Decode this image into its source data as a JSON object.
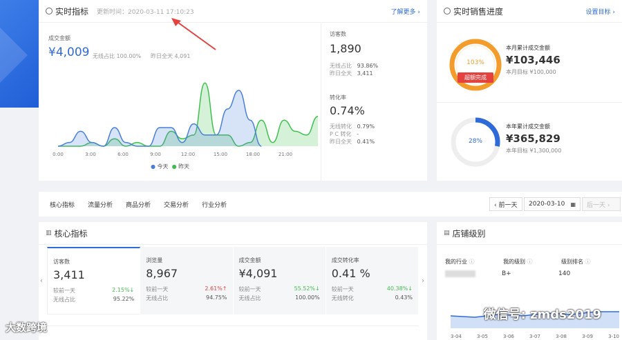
{
  "realtime": {
    "title": "实时指标",
    "updated": "更新时间：2020-03-11 17:10:23",
    "more": "了解更多 ›",
    "deal_label": "成交金额",
    "deal_value": "¥4,009",
    "wireless_ratio": "无线占比  100.00%",
    "yesterday_all": "昨日全天  4,091",
    "legend_today": "今天",
    "legend_yesterday": "昨天",
    "visitors_label": "访客数",
    "visitors_value": "1,890",
    "v_wireless_label": "无线占比",
    "v_wireless_value": "93.86%",
    "v_yday_label": "昨日全天",
    "v_yday_value": "3,411",
    "conv_label": "转化率",
    "conv_value": "0.74%",
    "c_wireless_label": "无线转化",
    "c_wireless_value": "0.79%",
    "c_pc_label": "P C 转化",
    "c_pc_value": "-",
    "c_yday_label": "昨日全天",
    "c_yday_value": "0.41%"
  },
  "chart_data": {
    "type": "area",
    "x": [
      "0:00",
      "3:00",
      "6:00",
      "9:00",
      "12:00",
      "15:00",
      "18:00",
      "21:00"
    ],
    "series": [
      {
        "name": "今天",
        "color": "#4a7fd9",
        "values": [
          0,
          0.1,
          0.4,
          0.1,
          0,
          0.5,
          0.1,
          0,
          0,
          0.5,
          0.5,
          0.1,
          0.6,
          0.3,
          0.3,
          1,
          1.5,
          0.7,
          0
        ]
      },
      {
        "name": "昨天",
        "color": "#3fbf4f",
        "values": [
          0,
          0,
          0,
          0.1,
          0,
          0.2,
          0,
          0.1,
          0,
          0,
          0.4,
          0.2,
          0.3,
          1.7,
          0.3,
          0.3,
          0,
          0.1,
          0.7,
          0.1,
          0.7,
          0.4,
          0.3,
          0.8
        ]
      }
    ]
  },
  "progress": {
    "title": "实时销售进度",
    "settings": "设置目标 ›",
    "month_pct": "103%",
    "month_badge": "超额完成",
    "month_label": "本月累计成交金额",
    "month_value": "¥103,446",
    "month_target": "本月目标 ¥100,000",
    "year_pct": "28%",
    "year_label": "本年累计成交金额",
    "year_value": "¥365,829",
    "year_target": "本年目标 ¥1,300,000",
    "year_fraction": 0.28
  },
  "tabs": [
    "核心指标",
    "流量分析",
    "商品分析",
    "交易分析",
    "行业分析"
  ],
  "datenav": {
    "prev": "‹ 前一天",
    "date": "2020-03-10",
    "next": "后一天 ›"
  },
  "core": {
    "title": "核心指标",
    "cells": [
      {
        "label": "访客数",
        "value": "3,411",
        "r1l": "较前一天",
        "r1v": "2.15%↓",
        "r2l": "无线占比",
        "r2v": "95.22%"
      },
      {
        "label": "浏览量",
        "value": "8,967",
        "r1l": "较前一天",
        "r1v": "2.61%↑",
        "r2l": "无线占比",
        "r2v": "94.75%"
      },
      {
        "label": "成交金额",
        "value": "¥4,091",
        "r1l": "较前一天",
        "r1v": "55.52%↓",
        "r2l": "无线占比",
        "r2v": "100.00%"
      },
      {
        "label": "成交转化率",
        "value": "0.41 %",
        "r1l": "较前一天",
        "r1v": "40.38%↓",
        "r2l": "无线转化",
        "r2v": "0.43%"
      }
    ]
  },
  "shop": {
    "title": "店铺级别",
    "industry_label": "我的行业",
    "level_label": "我的级别",
    "rank_label": "级别排名",
    "level_value": "B+",
    "rank_value": "140",
    "axis": [
      "3-04",
      "3-05",
      "3-06",
      "3-07",
      "3-08",
      "3-09",
      "3-10"
    ]
  },
  "watermark": "微信号: zmds2019",
  "watermark2": "大数跨境"
}
